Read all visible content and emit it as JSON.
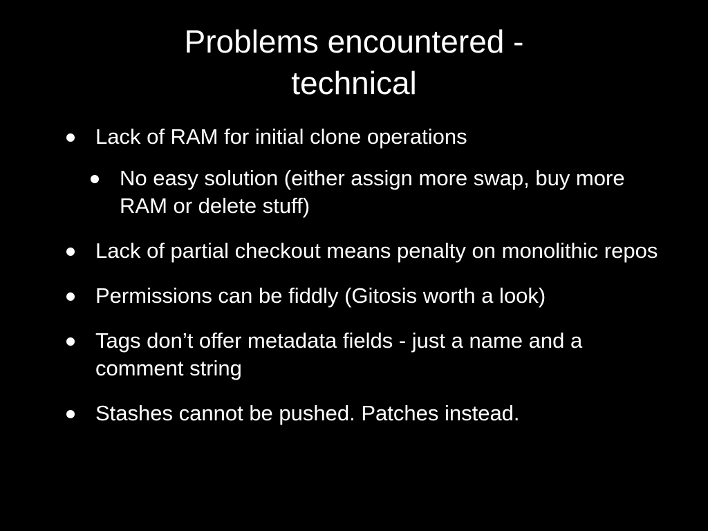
{
  "slide": {
    "title_line1": "Problems encountered -",
    "title_line2": "technical",
    "bullets": [
      {
        "text": "Lack of RAM for initial clone operations"
      },
      {
        "text": "No easy solution (either assign more swap, buy more RAM or delete stuff)"
      },
      {
        "text": "Lack of partial checkout means penalty on monolithic repos"
      },
      {
        "text": "Permissions can be fiddly (Gitosis worth a look)"
      },
      {
        "text": "Tags don’t offer metadata fields - just a name and a comment string"
      },
      {
        "text": "Stashes cannot be pushed. Patches instead."
      }
    ]
  },
  "colors": {
    "background": "#000000",
    "text": "#ffffff"
  }
}
